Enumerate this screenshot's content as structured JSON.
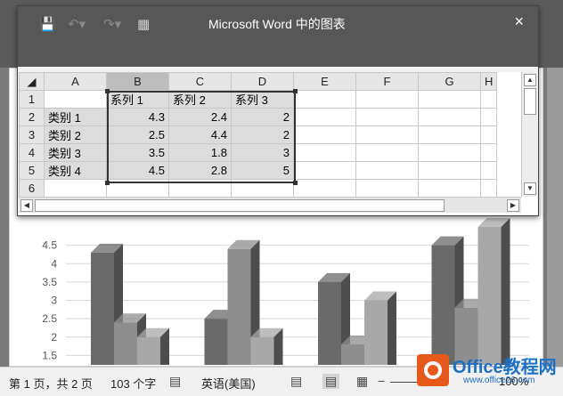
{
  "window": {
    "title": "Microsoft Word 中的图表",
    "close_icon": "×",
    "icons": {
      "save": "save-icon",
      "undo": "undo-icon",
      "redo": "redo-icon",
      "edit_in_excel": "edit-data-in-excel-icon"
    }
  },
  "sheet": {
    "column_headers": [
      "A",
      "B",
      "C",
      "D",
      "E",
      "F",
      "G",
      "H"
    ],
    "row_headers": [
      "1",
      "2",
      "3",
      "4",
      "5",
      "6"
    ],
    "rows": [
      [
        "",
        "系列 1",
        "系列 2",
        "系列 3"
      ],
      [
        "类别 1",
        "4.3",
        "2.4",
        "2"
      ],
      [
        "类别 2",
        "2.5",
        "4.4",
        "2"
      ],
      [
        "类别 3",
        "3.5",
        "1.8",
        "3"
      ],
      [
        "类别 4",
        "4.5",
        "2.8",
        "5"
      ],
      [
        "",
        "",
        "",
        ""
      ]
    ]
  },
  "chart_data": {
    "type": "bar",
    "categories": [
      "类别 1",
      "类别 2",
      "类别 3",
      "类别 4"
    ],
    "series": [
      {
        "values": [
          4.3,
          2.5,
          3.5,
          4.5
        ]
      },
      {
        "values": [
          2.4,
          4.4,
          1.8,
          2.8
        ]
      },
      {
        "values": [
          2,
          2,
          3,
          5
        ]
      }
    ],
    "ytick_labels": [
      "4.5",
      "4",
      "3.5",
      "3",
      "2.5",
      "2",
      "1.5"
    ],
    "ylim": [
      0,
      5
    ],
    "colors": [
      "#6a6a6a",
      "#8e8e8e",
      "#a8a8a8"
    ]
  },
  "statusbar": {
    "page": "第 1 页，共 2 页",
    "words": "103 个字",
    "language": "英语(美国)",
    "zoom": "100%"
  },
  "watermark": {
    "name": "Office教程网",
    "url": "www.office26.com"
  }
}
